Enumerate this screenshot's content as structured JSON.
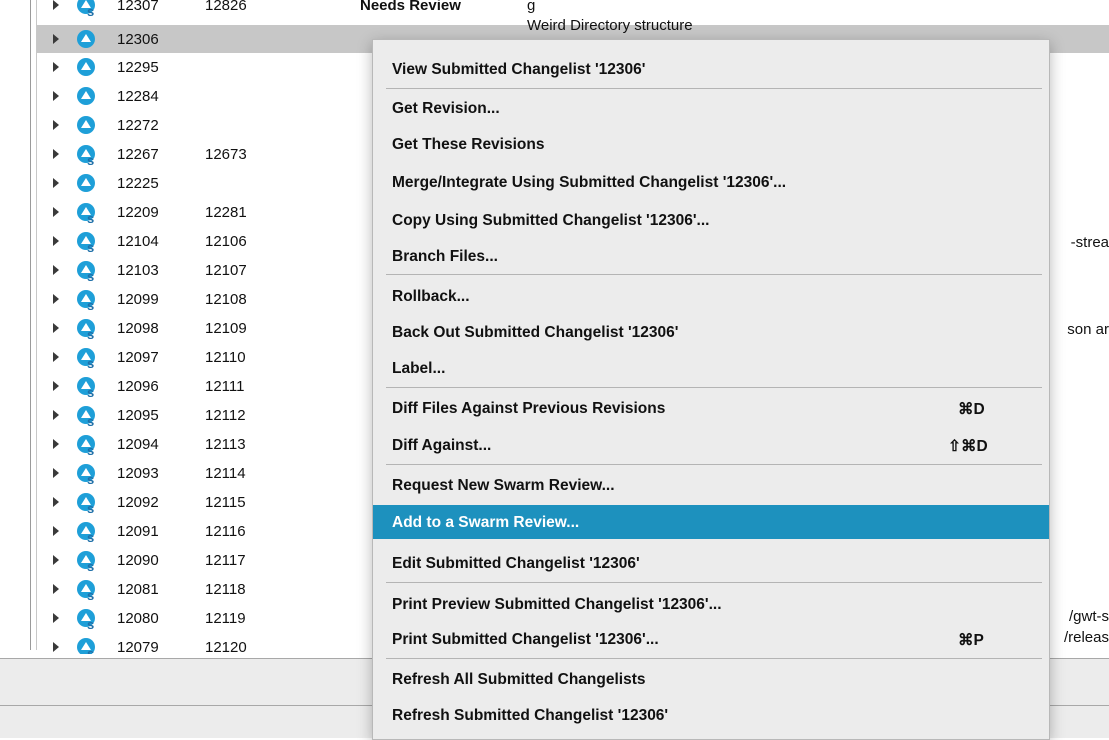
{
  "changelists": [
    {
      "id": "12307",
      "shelved": "12826",
      "status": "Needs Review",
      "desc": "g"
    },
    {
      "id": "12306",
      "shelved": "",
      "status": "",
      "desc": "Weird Directory structure"
    },
    {
      "id": "12295",
      "shelved": ""
    },
    {
      "id": "12284",
      "shelved": ""
    },
    {
      "id": "12272",
      "shelved": ""
    },
    {
      "id": "12267",
      "shelved": "12673"
    },
    {
      "id": "12225",
      "shelved": ""
    },
    {
      "id": "12209",
      "shelved": "12281"
    },
    {
      "id": "12104",
      "shelved": "12106"
    },
    {
      "id": "12103",
      "shelved": "12107"
    },
    {
      "id": "12099",
      "shelved": "12108"
    },
    {
      "id": "12098",
      "shelved": "12109"
    },
    {
      "id": "12097",
      "shelved": "12110"
    },
    {
      "id": "12096",
      "shelved": "12111"
    },
    {
      "id": "12095",
      "shelved": "12112"
    },
    {
      "id": "12094",
      "shelved": "12113"
    },
    {
      "id": "12093",
      "shelved": "12114"
    },
    {
      "id": "12092",
      "shelved": "12115"
    },
    {
      "id": "12091",
      "shelved": "12116"
    },
    {
      "id": "12090",
      "shelved": "12117"
    },
    {
      "id": "12081",
      "shelved": "12118"
    },
    {
      "id": "12080",
      "shelved": "12119"
    },
    {
      "id": "12079",
      "shelved": "12120"
    }
  ],
  "right_fragments": [
    "-strea",
    "son ar",
    "/gwt-s",
    "/releas"
  ],
  "context_menu": {
    "items": [
      {
        "label": "View Submitted Changelist '12306'"
      },
      {
        "label": "Get Revision..."
      },
      {
        "label": "Get These Revisions"
      },
      {
        "label": "Merge/Integrate Using Submitted Changelist '12306'..."
      },
      {
        "label": "Copy Using Submitted Changelist '12306'..."
      },
      {
        "label": "Branch Files..."
      },
      {
        "label": "Rollback..."
      },
      {
        "label": "Back Out Submitted Changelist '12306'"
      },
      {
        "label": "Label..."
      },
      {
        "label": "Diff Files Against Previous Revisions",
        "shortcut": "⌘D"
      },
      {
        "label": "Diff Against...",
        "shortcut": "⇧⌘D"
      },
      {
        "label": "Request New Swarm Review..."
      },
      {
        "label": "Add to a Swarm Review..."
      },
      {
        "label": "Edit Submitted Changelist '12306'"
      },
      {
        "label": "Print Preview Submitted Changelist '12306'..."
      },
      {
        "label": "Print Submitted Changelist '12306'...",
        "shortcut": "⌘P"
      },
      {
        "label": "Refresh All Submitted Changelists"
      },
      {
        "label": "Refresh Submitted Changelist '12306'"
      }
    ]
  },
  "colors": {
    "highlight": "#1d91be",
    "selected_row": "#c7c7c7",
    "icon": "#1e9fd8"
  }
}
